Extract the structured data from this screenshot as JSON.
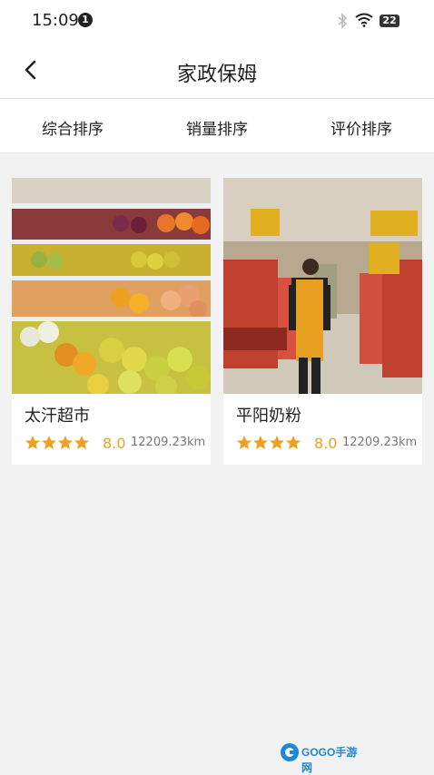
{
  "status": {
    "time": "15:09",
    "notification_count": "1",
    "battery": "22"
  },
  "header": {
    "title": "家政保姆",
    "back_icon": "chevron-left-icon"
  },
  "sort_tabs": [
    {
      "label": "综合排序"
    },
    {
      "label": "销量排序"
    },
    {
      "label": "评价排序"
    }
  ],
  "items": [
    {
      "name": "太汗超市",
      "stars": 4,
      "rating": "8.0",
      "distance": "12209.23km",
      "image": "supermarket-fruit-shelves"
    },
    {
      "name": "平阳奶粉",
      "stars": 4,
      "rating": "8.0",
      "distance": "12209.23km",
      "image": "supermarket-aisle-clerk"
    }
  ],
  "colors": {
    "star": "#f0a020",
    "rating": "#f0a020",
    "background": "#f2f2f2"
  },
  "watermark": {
    "text": "GOGO手游网"
  }
}
